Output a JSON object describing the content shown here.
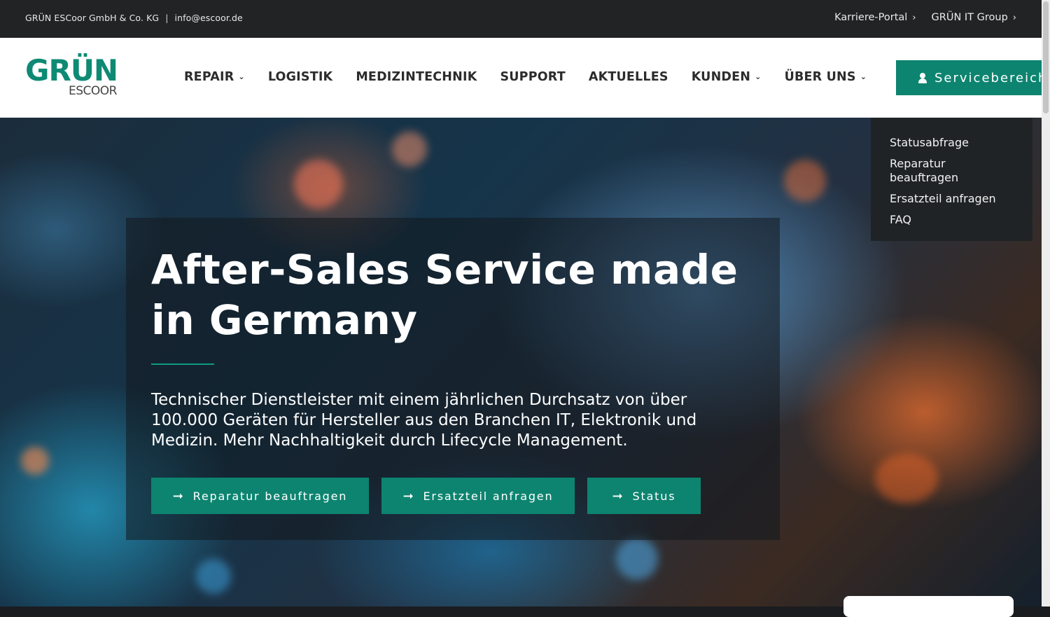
{
  "topbar": {
    "company": "GRÜN ESCoor GmbH & Co. KG",
    "separator": "|",
    "email": "info@escoor.de",
    "links": [
      {
        "label": "Karriere-Portal",
        "icon": "chevron-right-icon"
      },
      {
        "label": "GRÜN IT Group",
        "icon": "chevron-right-icon"
      }
    ]
  },
  "logo": {
    "line1": "GRÜN",
    "line2": "ESCOOR",
    "color": "#0e8a74"
  },
  "nav": {
    "items": [
      {
        "label": "REPAIR",
        "has_dropdown": true
      },
      {
        "label": "LOGISTIK",
        "has_dropdown": false
      },
      {
        "label": "MEDIZINTECHNIK",
        "has_dropdown": false
      },
      {
        "label": "SUPPORT",
        "has_dropdown": false
      },
      {
        "label": "AKTUELLES",
        "has_dropdown": false
      },
      {
        "label": "KUNDEN",
        "has_dropdown": true
      },
      {
        "label": "ÜBER UNS",
        "has_dropdown": true
      }
    ],
    "service_button": {
      "label": "Servicebereich",
      "icon": "user-icon"
    }
  },
  "dropdown": {
    "items": [
      "Statusabfrage",
      "Reparatur beauftragen",
      "Ersatzteil anfragen",
      "FAQ"
    ]
  },
  "hero": {
    "headline": "After-Sales Service made in Germany",
    "subtext": "Technischer Dienstleister mit einem jährlichen Durchsatz von über 100.000 Geräten für Hersteller aus den Branchen IT, Elektronik und Medizin. Mehr Nachhaltigkeit durch Lifecycle Management.",
    "buttons": [
      {
        "label": "Reparatur beauftragen",
        "icon": "arrow-right-icon"
      },
      {
        "label": "Ersatzteil anfragen",
        "icon": "arrow-right-icon"
      },
      {
        "label": "Status",
        "icon": "arrow-right-icon"
      }
    ]
  },
  "colors": {
    "accent": "#0d8470",
    "topbar_bg": "#222325",
    "dropdown_bg": "#1f2326"
  }
}
